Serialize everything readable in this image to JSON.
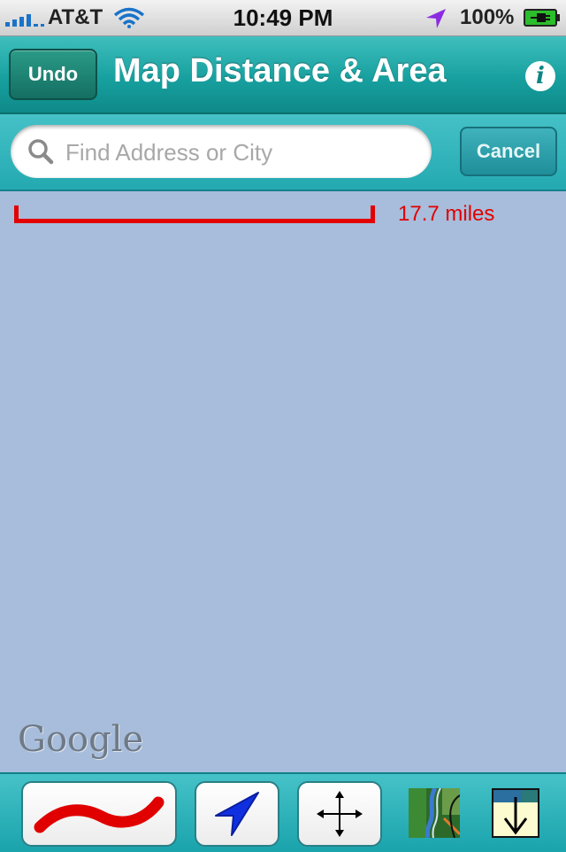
{
  "status_bar": {
    "carrier": "AT&T",
    "time": "10:49 PM",
    "battery": "100%",
    "icons": [
      "signal-bars-icon",
      "wifi-icon",
      "location-arrow-icon",
      "battery-charging-icon"
    ]
  },
  "header": {
    "undo_label": "Undo",
    "title": "Map Distance & Area",
    "info_label": "i"
  },
  "search": {
    "placeholder": "Find Address or City",
    "value": "",
    "cancel_label": "Cancel"
  },
  "map": {
    "scale_label": "17.7 miles",
    "attribution": "Google"
  },
  "toolbar": {
    "tools": [
      "draw-line-icon",
      "location-arrow-icon",
      "pan-move-icon",
      "map-type-icon",
      "download-icon"
    ]
  },
  "colors": {
    "header": "#17a09f",
    "map_background": "#a7bddb",
    "scale": "#e30000",
    "draw_stroke": "#e00000",
    "locate_arrow": "#1030e0"
  }
}
